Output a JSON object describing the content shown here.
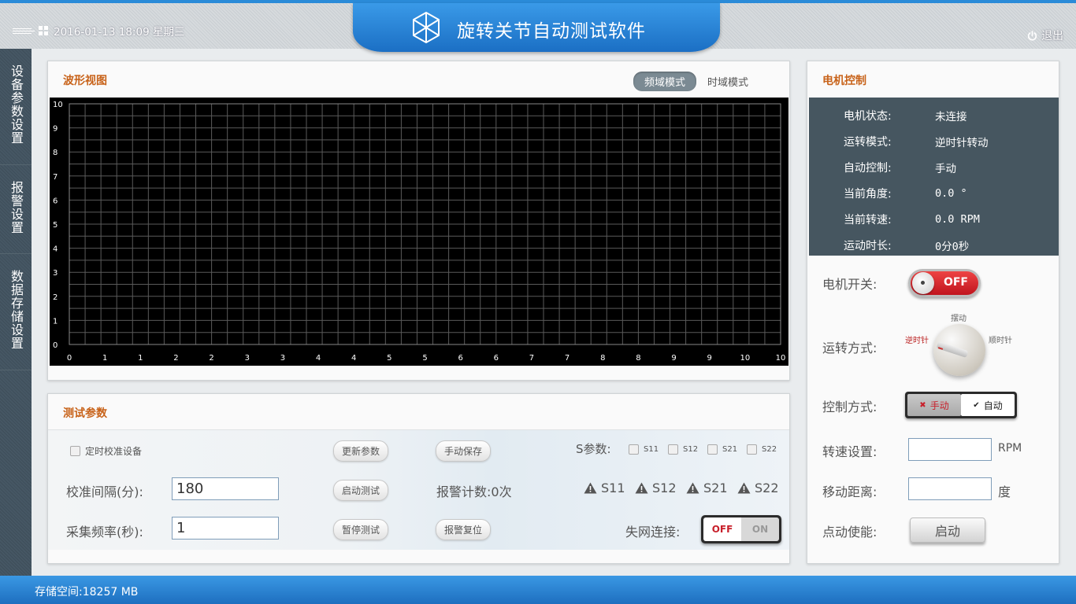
{
  "header": {
    "datetime": "2016-01-13 18:09 星期三",
    "title": "旋转关节自动测试软件",
    "logout": "退出"
  },
  "sidenav": {
    "items": [
      "设备参数设置",
      "报警设置",
      "数据存储设置"
    ]
  },
  "wave": {
    "title": "波形视图",
    "mode_freq": "频域模式",
    "mode_time": "时域模式",
    "active_mode": "频域模式"
  },
  "chart_data": {
    "type": "line",
    "title": "",
    "xlabel": "",
    "ylabel": "",
    "xlim": [
      0,
      10
    ],
    "ylim": [
      0,
      10
    ],
    "x_ticks": [
      "0",
      "1",
      "1",
      "2",
      "2",
      "3",
      "3",
      "4",
      "4",
      "5",
      "5",
      "6",
      "6",
      "7",
      "7",
      "8",
      "8",
      "9",
      "9",
      "10",
      "10"
    ],
    "y_ticks": [
      "0",
      "1",
      "2",
      "3",
      "4",
      "5",
      "6",
      "7",
      "8",
      "9",
      "10"
    ],
    "grid": true,
    "series": []
  },
  "test": {
    "title": "测试参数",
    "calib_checkbox": "定时校准设备",
    "btn_update": "更新参数",
    "btn_save": "手动保存",
    "btn_start": "启动测试",
    "btn_pause": "暂停测试",
    "btn_reset": "报警复位",
    "s_params_label": "S参数:",
    "s_params": [
      "S11",
      "S12",
      "S21",
      "S22"
    ],
    "interval_label": "校准间隔(分):",
    "interval_value": "180",
    "freq_label": "采集频率(秒):",
    "freq_value": "1",
    "alarm_count": "报警计数:0次",
    "alarms": [
      "S11",
      "S12",
      "S21",
      "S22"
    ],
    "network_label": "失网连接:",
    "network_off": "OFF",
    "network_on": "ON"
  },
  "motor": {
    "title": "电机控制",
    "status": [
      {
        "k": "电机状态:",
        "v": "未连接"
      },
      {
        "k": "运转模式:",
        "v": "逆时针转动"
      },
      {
        "k": "自动控制:",
        "v": "手动"
      },
      {
        "k": "当前角度:",
        "v": "0.0 °"
      },
      {
        "k": "当前转速:",
        "v": "0.0 RPM"
      },
      {
        "k": "运动时长:",
        "v": "0分0秒"
      }
    ],
    "switch_label": "电机开关:",
    "switch_state": "OFF",
    "rotation_label": "运转方式:",
    "knob_ccw": "逆时针",
    "knob_swing": "摆动",
    "knob_cw": "顺时针",
    "control_label": "控制方式:",
    "control_manual": "手动",
    "control_auto": "自动",
    "speed_label": "转速设置:",
    "speed_unit": "RPM",
    "distance_label": "移动距离:",
    "distance_unit": "度",
    "jog_label": "点动使能:",
    "jog_button": "启动"
  },
  "footer": {
    "storage": "存储空间:18257 MB"
  },
  "colors": {
    "accent_blue": "#1e6fc0",
    "title_orange": "#c8631a",
    "status_panel": "#465660",
    "alert_red": "#c8202b"
  }
}
